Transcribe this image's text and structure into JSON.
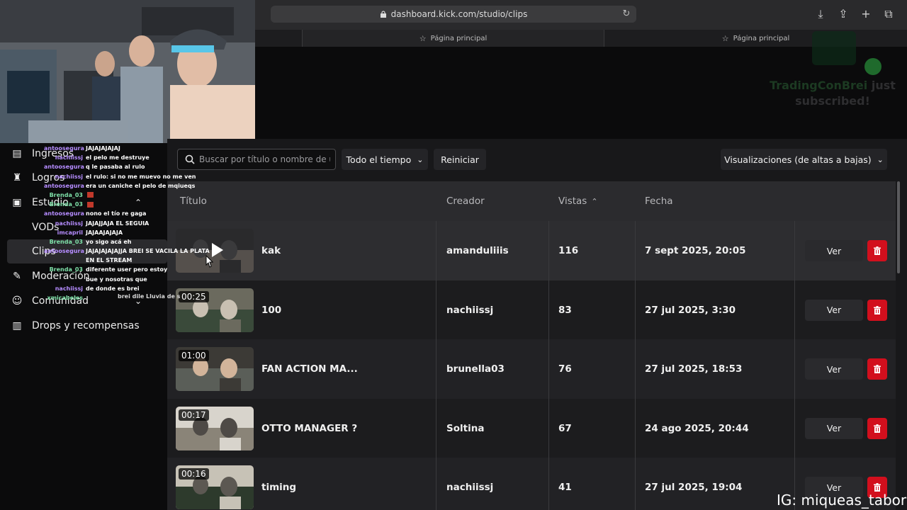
{
  "browser": {
    "url": "dashboard.kick.com/studio/clips",
    "tabs": [
      {
        "label": "Página principal"
      },
      {
        "label": "Página principal"
      }
    ]
  },
  "notification": {
    "user": "TradingConBrei",
    "text_suffix": "just",
    "text_line2": "subscribed!"
  },
  "sidebar": {
    "items": [
      {
        "label": "Ingresos",
        "icon": "bar-chart-icon"
      },
      {
        "label": "Logros",
        "icon": "trophy-icon"
      },
      {
        "label": "Estudio",
        "icon": "film-icon"
      },
      {
        "label": "VODs",
        "icon": ""
      },
      {
        "label": "Clips",
        "icon": ""
      },
      {
        "label": "Moderación",
        "icon": "wrench-icon"
      },
      {
        "label": "Comunidad",
        "icon": "users-icon"
      },
      {
        "label": "Drops y recompensas",
        "icon": "gift-chart-icon"
      }
    ]
  },
  "chat": [
    {
      "user": "antoosegura",
      "msg": "JAJAJAJAJAJ",
      "color": "#b58cff"
    },
    {
      "user": "nachiissj",
      "msg": "el pelo me destruye",
      "color": "#b58cff"
    },
    {
      "user": "antoosegura",
      "msg": "q le pasaba al rulo",
      "color": "#b58cff"
    },
    {
      "user": "nachiissj",
      "msg": "el rulo: si no me muevo no me ven",
      "color": "#b58cff"
    },
    {
      "user": "antoosegura",
      "msg": "era un caniche el pelo de mqiueqs",
      "color": "#b58cff"
    },
    {
      "user": "Brenda_03",
      "msg": "",
      "color": "#7ee0a8"
    },
    {
      "user": "Brenda_03",
      "msg": "",
      "color": "#7ee0a8"
    },
    {
      "user": "antoosegura",
      "msg": "nono el tío re gaga",
      "color": "#b58cff"
    },
    {
      "user": "nachiissj",
      "msg": "JAJAJJAJA EL SEGUIA",
      "color": "#b58cff"
    },
    {
      "user": "imcapril",
      "msg": "JAJAAJAJAJA",
      "color": "#b58cff"
    },
    {
      "user": "Brenda_03",
      "msg": "yo sigo acá eh",
      "color": "#7ee0a8"
    },
    {
      "user": "antoosegura",
      "msg": "JAJAJAJAJAJJA BREI SE VACILA LA PLATA",
      "color": "#b58cff"
    },
    {
      "user": "",
      "msg": "EN EL STREAM",
      "color": "#b58cff"
    },
    {
      "user": "Brenda_03",
      "msg": "diferente user pero estoy",
      "color": "#7ee0a8"
    },
    {
      "user": "",
      "msg": "bue y nosotras que",
      "color": "#b58cff"
    },
    {
      "user": "nachiissj",
      "msg": "de donde es brei",
      "color": "#b58cff"
    },
    {
      "user": "xmicabeles",
      "msg": "",
      "color": "#7ee0a8"
    }
  ],
  "chat_extra": "brei dile Lluvia de s",
  "toolbar": {
    "search_placeholder": "Buscar por título o nombre de us",
    "time_filter": "Todo el tiempo",
    "reset_label": "Reiniciar",
    "sort_label": "Visualizaciones (de altas a bajas)"
  },
  "table": {
    "headers": {
      "title": "Título",
      "creator": "Creador",
      "views": "Vistas",
      "date": "Fecha"
    },
    "view_label": "Ver",
    "rows": [
      {
        "title": "kak",
        "creator": "amanduliiis",
        "views": "116",
        "date": "7 sept 2025, 20:05",
        "duration": ""
      },
      {
        "title": "100",
        "creator": "nachiissj",
        "views": "83",
        "date": "27 jul 2025, 3:30",
        "duration": "00:25"
      },
      {
        "title": "FAN ACTION MA...",
        "creator": "brunella03",
        "views": "76",
        "date": "27 jul 2025, 18:53",
        "duration": "01:00"
      },
      {
        "title": "OTTO MANAGER ?",
        "creator": "Soltina",
        "views": "67",
        "date": "24 ago 2025, 20:44",
        "duration": "00:17"
      },
      {
        "title": "timing",
        "creator": "nachiissj",
        "views": "41",
        "date": "27 jul 2025, 19:04",
        "duration": "00:16"
      }
    ]
  },
  "watermark": "IG: miqueas_tabor",
  "colors": {
    "delete": "#d20f1d",
    "accent_green": "#53fc18"
  }
}
